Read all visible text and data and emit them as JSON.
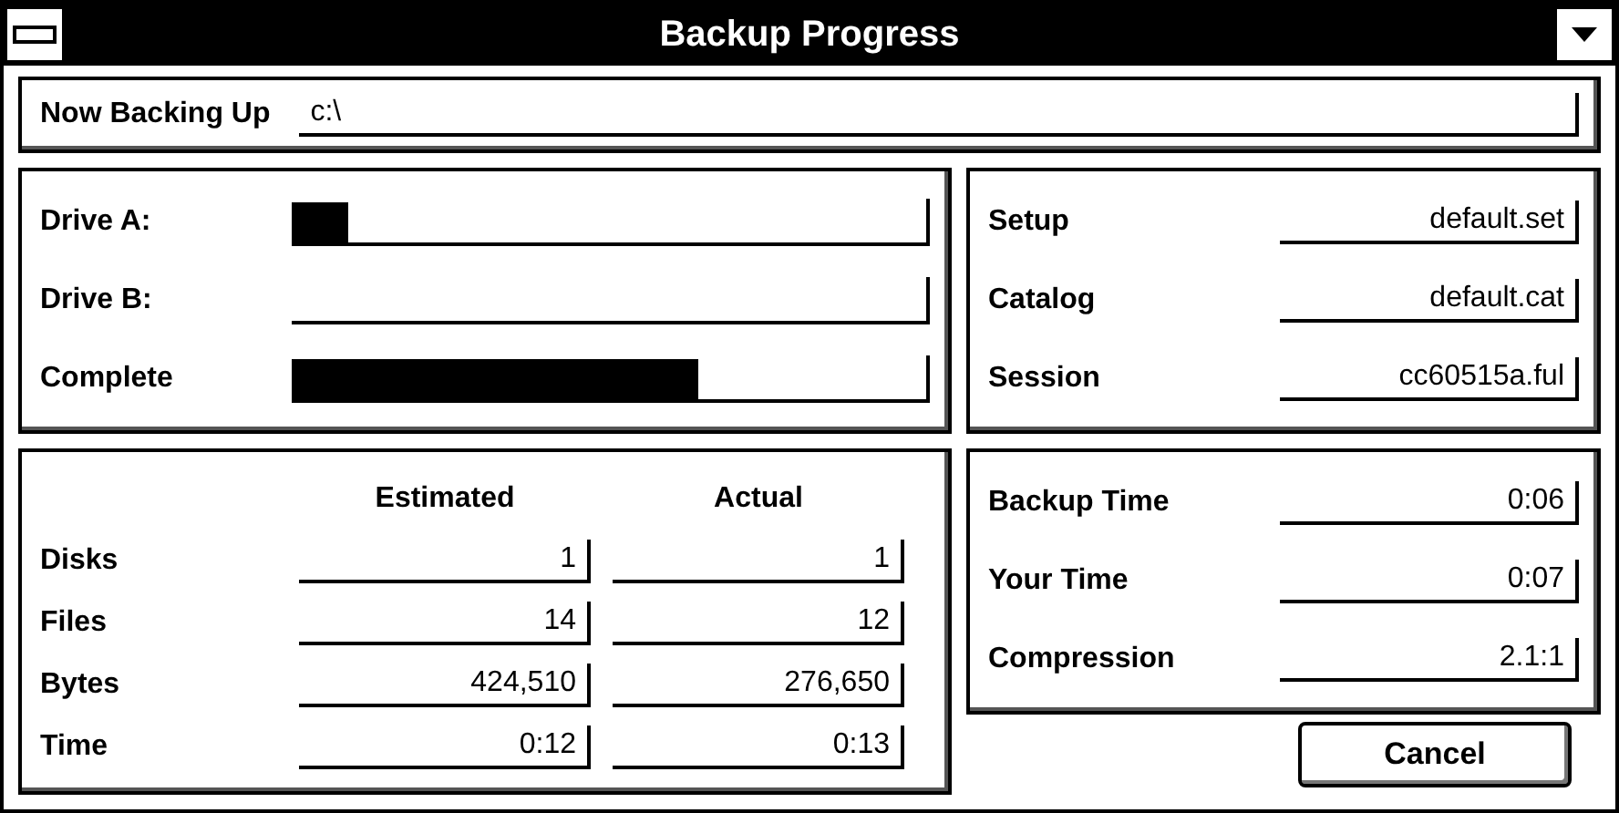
{
  "window": {
    "title": "Backup Progress"
  },
  "now_backing_up": {
    "label": "Now Backing Up",
    "value": "c:\\"
  },
  "drives": [
    {
      "label": "Drive A:",
      "level": 0.09
    },
    {
      "label": "Drive B:",
      "level": 0
    },
    {
      "label": "Complete",
      "level": 0.64
    }
  ],
  "files": [
    {
      "label": "Setup",
      "value": "default.set"
    },
    {
      "label": "Catalog",
      "value": "default.cat"
    },
    {
      "label": "Session",
      "value": "cc60515a.ful"
    }
  ],
  "stats": {
    "columns": [
      "Estimated",
      "Actual"
    ],
    "rows": [
      {
        "label": "Disks",
        "estimated": "1",
        "actual": "1"
      },
      {
        "label": "Files",
        "estimated": "14",
        "actual": "12"
      },
      {
        "label": "Bytes",
        "estimated": "424,510",
        "actual": "276,650"
      },
      {
        "label": "Time",
        "estimated": "0:12",
        "actual": "0:13"
      }
    ]
  },
  "times": [
    {
      "label": "Backup Time",
      "value": "0:06"
    },
    {
      "label": "Your Time",
      "value": "0:07"
    },
    {
      "label": "Compression",
      "value": "2.1:1"
    }
  ],
  "buttons": [
    {
      "label": "Cancel"
    }
  ]
}
